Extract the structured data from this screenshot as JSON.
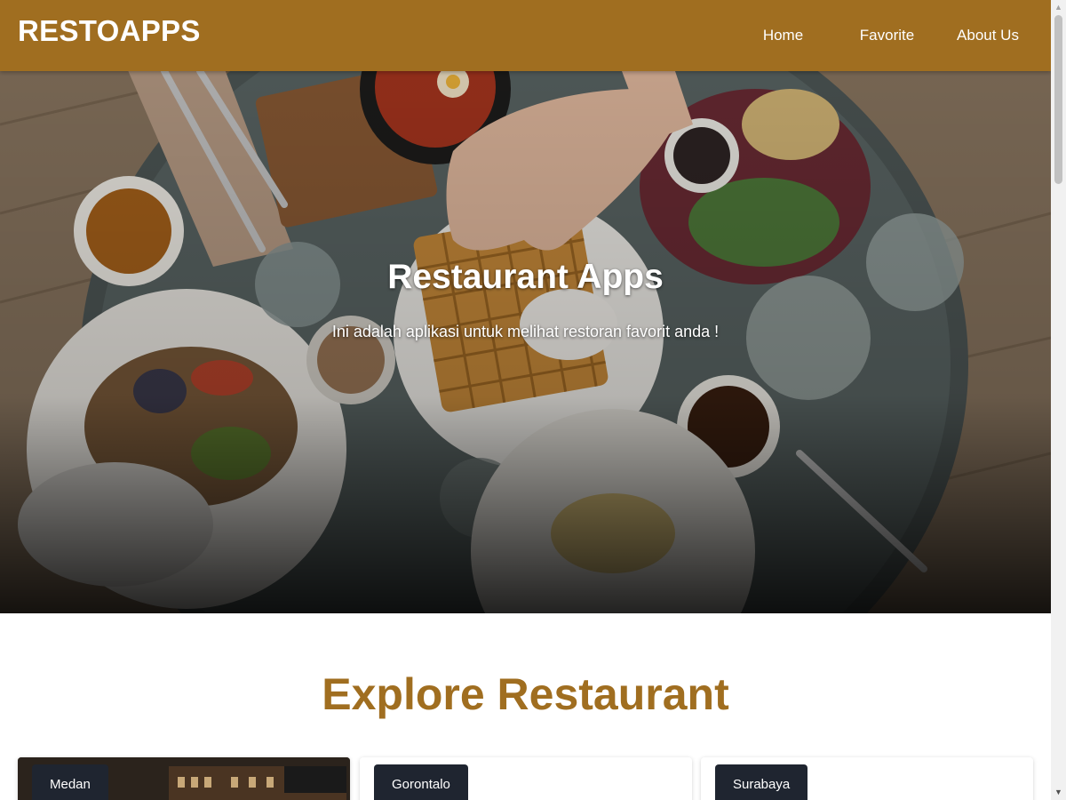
{
  "header": {
    "brand": "RESTOAPPS",
    "nav": [
      {
        "label": "Home"
      },
      {
        "label": "Favorite"
      },
      {
        "label": "About Us"
      }
    ]
  },
  "hero": {
    "title": "Restaurant Apps",
    "subtitle": "Ini adalah aplikasi untuk melihat restoran favorit anda !"
  },
  "explore": {
    "title": "Explore Restaurant",
    "cards": [
      {
        "city": "Medan"
      },
      {
        "city": "Gorontalo"
      },
      {
        "city": "Surabaya"
      }
    ]
  },
  "colors": {
    "header_bg": "#a06e20",
    "title_accent": "#a06e20",
    "badge_bg": "#1f2530"
  },
  "icons": {
    "scroll_up": "triangle-up-icon",
    "scroll_down": "triangle-down-icon"
  }
}
